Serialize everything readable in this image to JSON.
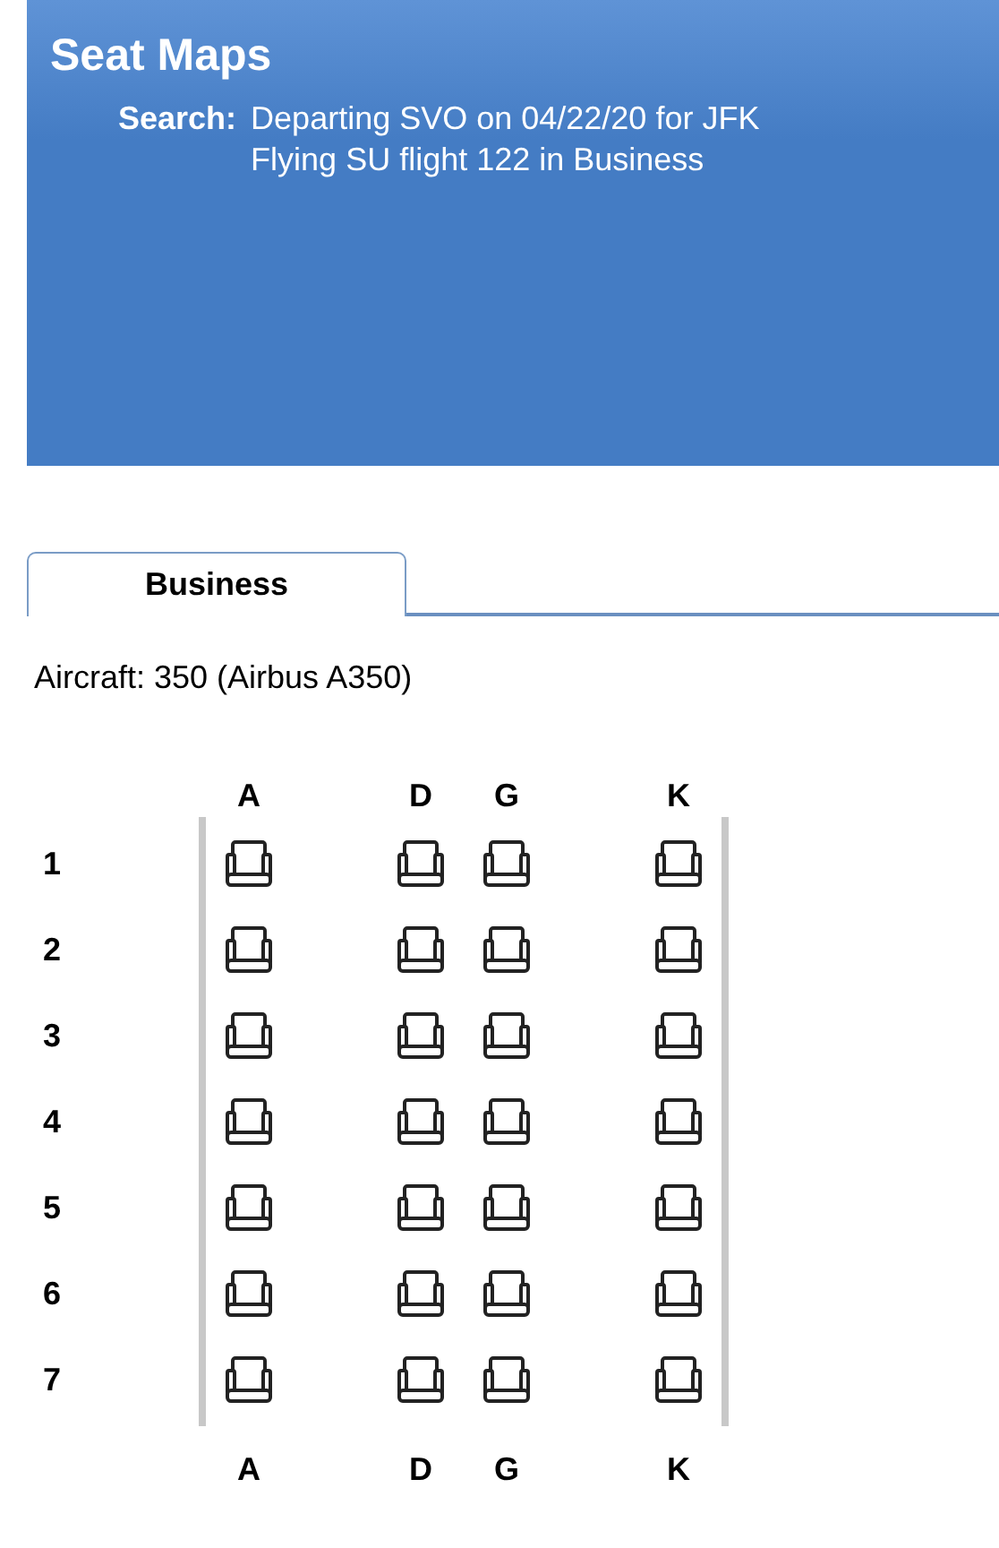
{
  "header": {
    "title": "Seat Maps",
    "search_label": "Search:",
    "search_lines": [
      "Departing SVO on 04/22/20 for JFK",
      "Flying SU flight 122 in Business"
    ]
  },
  "tabs": [
    {
      "label": "Business",
      "selected": true
    }
  ],
  "aircraft": "Aircraft: 350 (Airbus A350)",
  "columns_top": [
    {
      "kind": "seat",
      "label": "A"
    },
    {
      "kind": "aisle"
    },
    {
      "kind": "seat",
      "label": "D"
    },
    {
      "kind": "seat",
      "label": "G"
    },
    {
      "kind": "aisle"
    },
    {
      "kind": "seat",
      "label": "K"
    }
  ],
  "rows": [
    "1",
    "2",
    "3",
    "4",
    "5",
    "6",
    "7"
  ],
  "columns_bottom": [
    {
      "kind": "seat",
      "label": "A"
    },
    {
      "kind": "aisle"
    },
    {
      "kind": "seat",
      "label": "D"
    },
    {
      "kind": "seat",
      "label": "G"
    },
    {
      "kind": "aisle"
    },
    {
      "kind": "seat",
      "label": "K"
    }
  ]
}
